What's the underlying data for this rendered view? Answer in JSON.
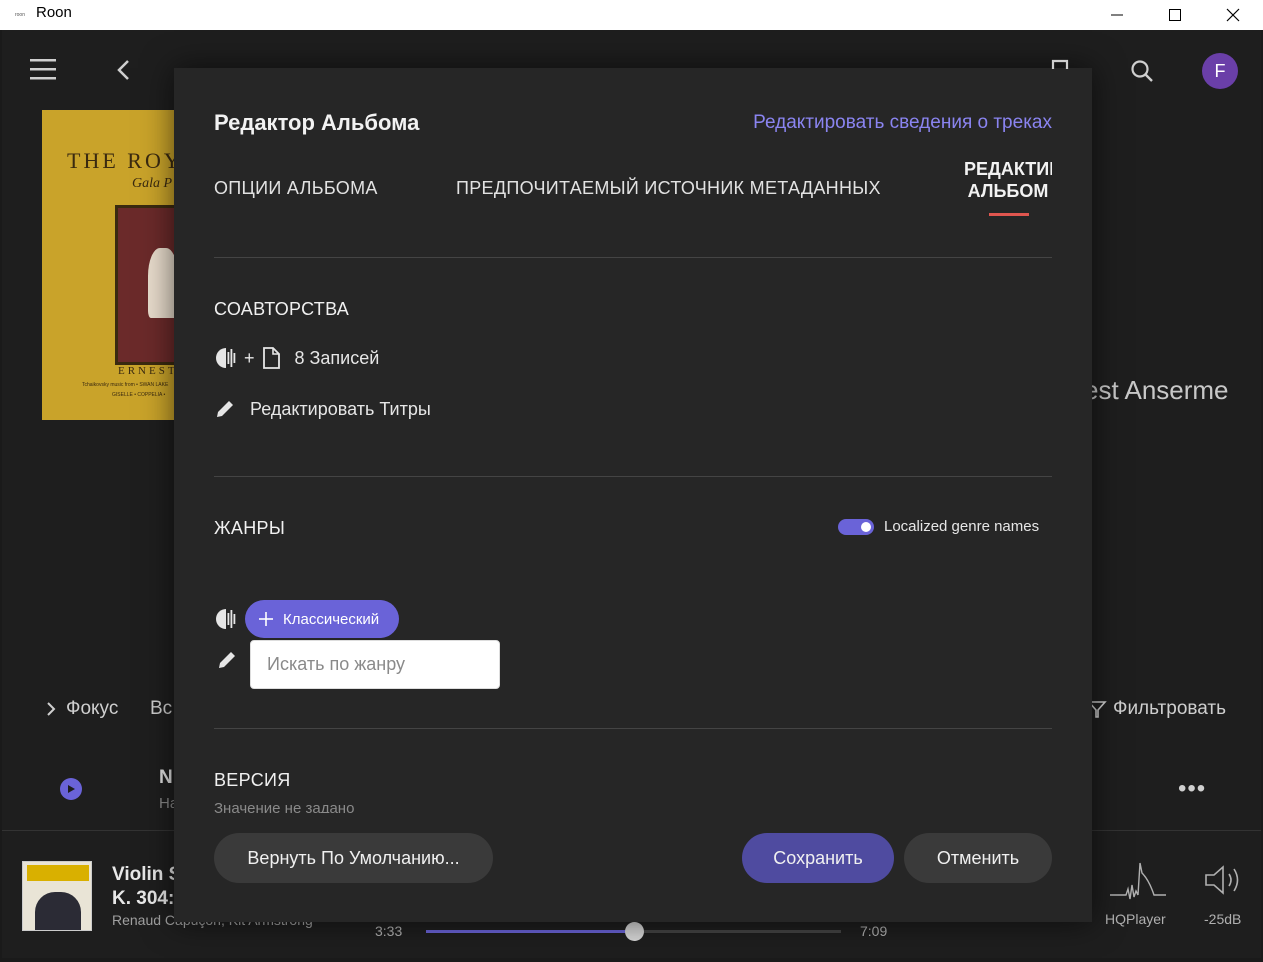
{
  "window": {
    "app_icon_text": "roon",
    "title": "Roon"
  },
  "icons": {
    "menu": "hamburger-icon",
    "back": "chevron-left-icon",
    "bookmark": "bookmark-icon",
    "search": "search-icon",
    "edit": "pencil-icon",
    "roon_source": "half-circle-waveform-icon",
    "file": "file-icon",
    "add": "plus-icon",
    "filter": "funnel-icon",
    "play": "play-icon",
    "more": "ellipsis-icon",
    "hqplayer": "hqplayer-icon",
    "volume": "speaker-icon"
  },
  "colors": {
    "accent": "#6a63d8",
    "link": "#8a84f0",
    "tab_underline": "#e0564f",
    "avatar": "#6a3fa8"
  },
  "user": {
    "avatar_letter": "F"
  },
  "background": {
    "cover": {
      "line1": "THE ROY",
      "line2": "Gala P",
      "line3": "ERNEST",
      "line4": "Tchaikovsky music from • SWAN LAKE",
      "line5": "GISELLE • COPPELIA •"
    },
    "artist_fragment": "est Anserme",
    "focus": "Фокус",
    "vse": "Вс",
    "filter": "Фильтровать",
    "row_title": "N",
    "row_sub": "Ha",
    "more": "•••"
  },
  "now_playing": {
    "title_line1": "Violin S",
    "title_line2": "K. 304:",
    "artist": "Renaud Capuçon, Kit Armstrong",
    "elapsed": "3:33",
    "total": "7:09",
    "progress": 0.5,
    "zone": "HQPlayer",
    "volume": "-25dB"
  },
  "modal": {
    "title": "Редактор Альбома",
    "edit_tracks_link": "Редактировать сведения о треках",
    "tabs": [
      {
        "label": "ОПЦИИ АЛЬБОМА"
      },
      {
        "label": "ПРЕДПОЧИТАЕМЫЙ ИСТОЧНИК МЕТАДАННЫХ"
      },
      {
        "label": "РЕДАКТИРОВАТЬ АЛЬБОМ",
        "active": true
      }
    ],
    "credits": {
      "heading": "СОАВТОРСТВА",
      "plus": "+",
      "records": "8 Записей",
      "edit_credits": "Редактировать Титры"
    },
    "genres": {
      "heading": "ЖАНРЫ",
      "localized_label": "Localized genre names",
      "localized_on": true,
      "chip": "Классический",
      "search_placeholder": "Искать по жанру"
    },
    "version": {
      "heading": "ВЕРСИЯ",
      "value": "Значение не задано"
    },
    "buttons": {
      "reset": "Вернуть По Умолчанию...",
      "save": "Сохранить",
      "cancel": "Отменить"
    }
  }
}
